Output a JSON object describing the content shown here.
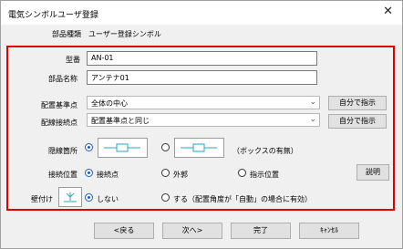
{
  "window": {
    "title": "電気シンボルユーザ登録",
    "close_glyph": "✕"
  },
  "part_kind": {
    "label": "部品種類",
    "value": "ユーザー登録シンボル"
  },
  "model_number": {
    "label": "型番",
    "value": "AN-01"
  },
  "part_name": {
    "label": "部品名称",
    "value": "アンテナ01"
  },
  "placement_ref": {
    "label": "配置基準点",
    "selected": "全体の中心",
    "button": "自分で指示"
  },
  "wire_point": {
    "label": "配線接続点",
    "selected": "配置基準点と同じ",
    "button": "自分で指示"
  },
  "hidden_line": {
    "label": "隠線箇所",
    "note": "（ボックスの有無）"
  },
  "connect_pos": {
    "label": "接続位置",
    "options": [
      "接続点",
      "外郭",
      "指示位置"
    ],
    "explain_button": "説明"
  },
  "wall_mount": {
    "label": "壁付け",
    "options": [
      "しない",
      "する（配置角度が「自動」の場合に有効）"
    ]
  },
  "footer": {
    "back": "<戻る",
    "next": "次へ>",
    "finish": "完了",
    "cancel": "ｷｬﾝｾﾙ"
  },
  "colors": {
    "highlight_border": "#e00000",
    "radio_accent": "#1a5fb4",
    "icon_cyan": "#2aa7b8"
  }
}
